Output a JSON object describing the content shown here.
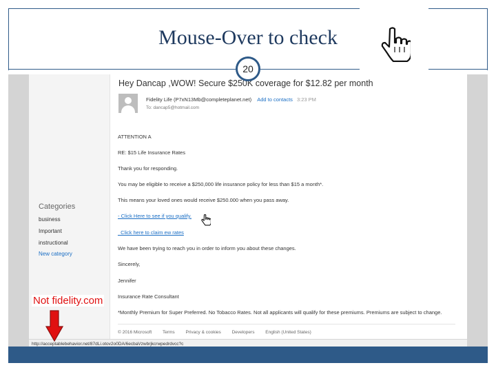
{
  "slide": {
    "title": "Mouse-Over to check",
    "page_number": "20",
    "annotation": "Not fidelity.com"
  },
  "icons": {
    "slide_cursor": "pointer-hand-icon",
    "link_cursor": "pointer-hand-icon",
    "arrow": "down-arrow-icon",
    "avatar": "user-avatar-icon"
  },
  "colors": {
    "frame": "#2e5a88",
    "title": "#1f3a5f",
    "annotation": "#e01010",
    "link": "#1a6ec4"
  },
  "email": {
    "subject": "Hey Dancap ,WOW! Secure $250K coverage for $12.82 per month",
    "sender": "Fidelity Life (P7xN13Mb@completeplanet.net)",
    "add_contacts": "Add to contacts",
    "time": "3:23 PM",
    "to": "To: dancap5@hotmail.com",
    "lines": [
      "ATTENTION A",
      "RE: $15 Life Insurance Rates",
      "Thank you for responding.",
      "You may be eligible to receive a $250,000 life insurance policy for less than $15 a month*.",
      "This means your loved ones would receive $250.000 when you pass away."
    ],
    "link1": "- Click Here to see if you qualify.",
    "link2": "_Click here to claim ew rates",
    "lines2": [
      "We have been trying to reach you in order to inform you about these changes.",
      "Sincerely,",
      "Jennifer",
      "Insurance Rate Consultant",
      "*Monthly Premium for Super Preferred. No Tobacco Rates. Not all applicants will qualify for these premiums. Premiums are subject to change."
    ],
    "footer": [
      "© 2016 Microsoft",
      "Terms",
      "Privacy & cookies",
      "Developers",
      "English (United States)"
    ],
    "status_url": "http://acceptablebehavior.net/87dLi.otov2o0DA/6ecbaVzwbrjkcrwpedrdvcc?c"
  },
  "sidebar": {
    "categories_title": "Categories",
    "items": [
      "business",
      "Important",
      "instructional"
    ],
    "new_category": "New category"
  }
}
